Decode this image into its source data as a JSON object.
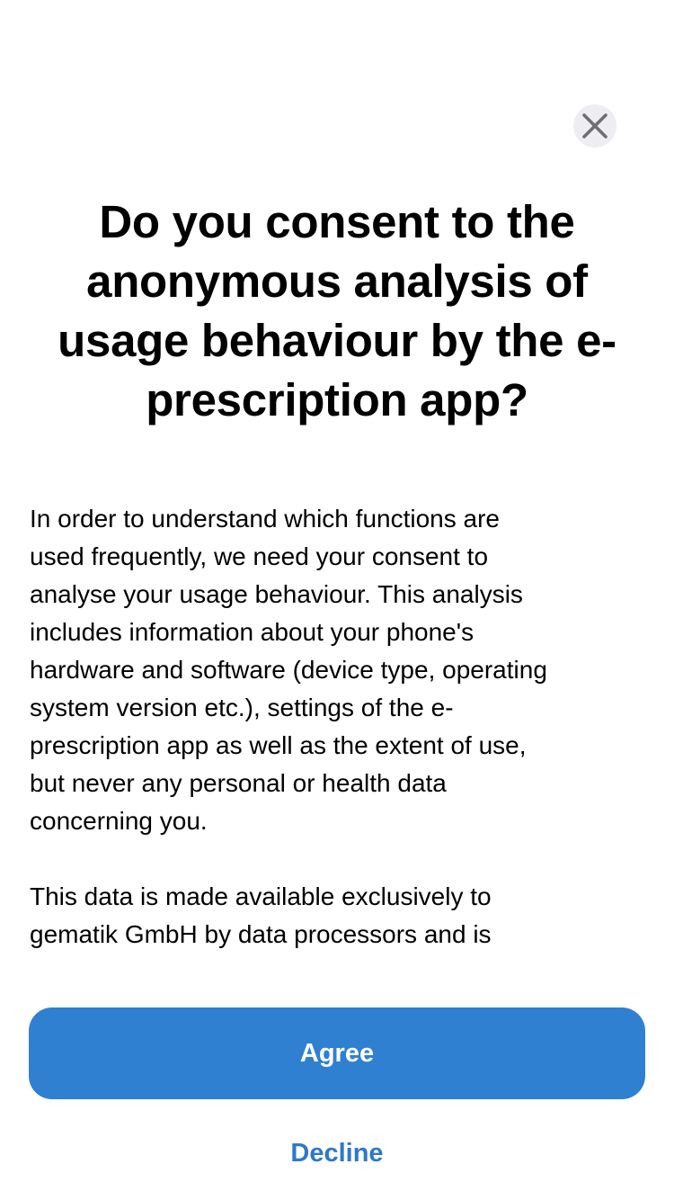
{
  "dialog": {
    "close_icon": "close-icon",
    "title": "Do you consent to the anonymous analysis of usage behaviour by the e-prescription app?",
    "paragraphs": [
      "In order to understand which functions are\nused frequently, we need your consent to\nanalyse your usage behaviour. This analysis\nincludes information about your phone's\nhardware and software (device type, operating\nsystem version etc.), settings of the e-\nprescription app as well as the extent of use,\nbut never any personal or health data\nconcerning you.",
      "This data is made available exclusively to\ngematik GmbH by data processors and is"
    ]
  },
  "actions": {
    "agree_label": "Agree",
    "decline_label": "Decline"
  },
  "colors": {
    "accent": "#2f80d0",
    "link": "#2f78c8",
    "close_background": "#eeeef2",
    "close_glyph": "#6e6e73"
  }
}
